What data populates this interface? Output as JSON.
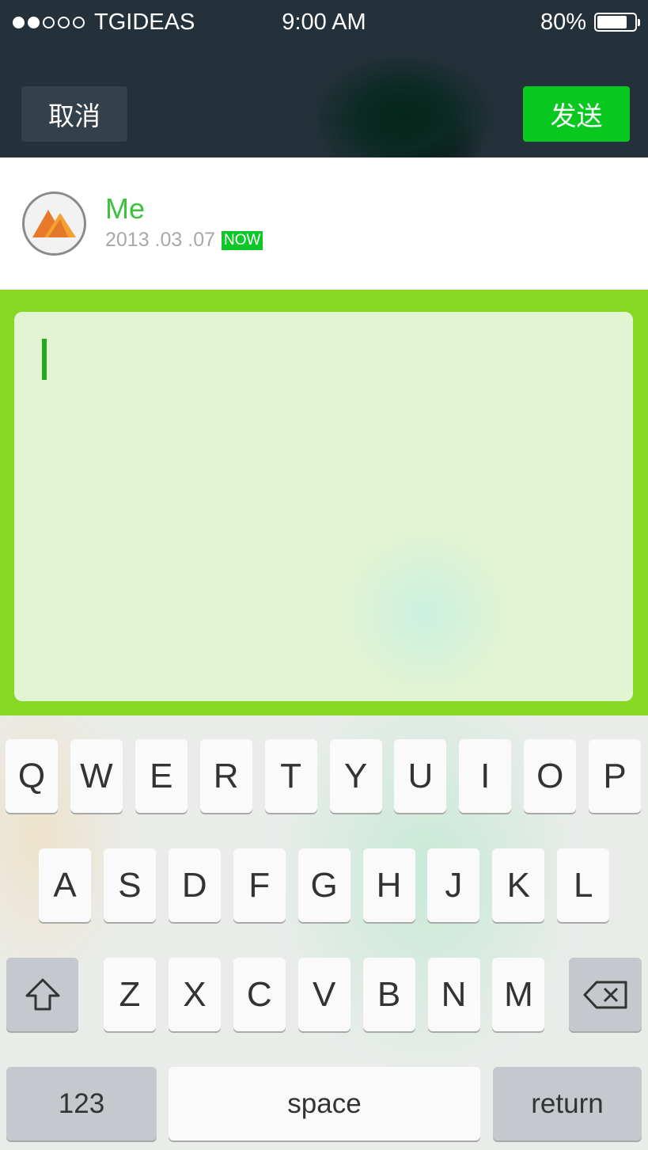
{
  "status_bar": {
    "carrier": "TGIDEAS",
    "time": "9:00 AM",
    "battery_text": "80%",
    "battery_level": 0.8,
    "signal_bars": 2,
    "signal_total": 5
  },
  "nav": {
    "cancel_label": "取消",
    "send_label": "发送"
  },
  "profile": {
    "name": "Me",
    "date": "2013 .03 .07",
    "badge": "NOW"
  },
  "compose": {
    "text": ""
  },
  "keyboard": {
    "row1": [
      "Q",
      "W",
      "E",
      "R",
      "T",
      "Y",
      "U",
      "I",
      "O",
      "P"
    ],
    "row2": [
      "A",
      "S",
      "D",
      "F",
      "G",
      "H",
      "J",
      "K",
      "L"
    ],
    "row3": [
      "Z",
      "X",
      "C",
      "V",
      "B",
      "N",
      "M"
    ],
    "numbers_label": "123",
    "space_label": "space",
    "return_label": "return",
    "shift_icon": "shift-icon",
    "delete_icon": "backspace-icon"
  },
  "colors": {
    "accent_green": "#08c820",
    "name_green": "#3cc23c",
    "compose_bg": "#86d822",
    "textbox_bg": "#e3f4d2",
    "nav_bg": "#25313a"
  }
}
